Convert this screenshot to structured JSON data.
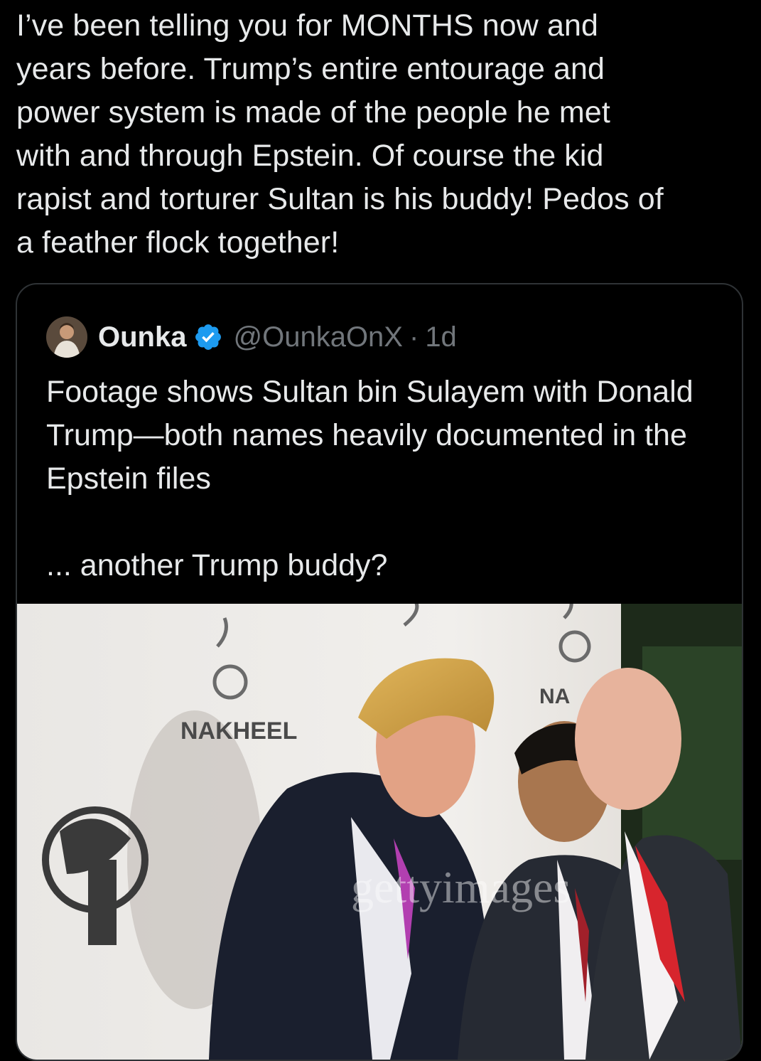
{
  "tweet": {
    "text": "I’ve been telling you for MONTHS now and\nyears before. Trump’s entire entourage and\npower system is made of the people he met\nwith and through Epstein. Of course the kid\nrapist and torturer Sultan is his buddy! Pedos of\na feather flock together!"
  },
  "quoted_tweet": {
    "author_name": "Ounka",
    "handle": "@OunkaOnX",
    "separator": "·",
    "time": "1d",
    "verified_icon": "verified-badge-icon",
    "text_line_1": "Footage shows Sultan bin Sulayem with Donald Trump—both names heavily documented in the Epstein files",
    "text_line_2": "... another Trump buddy?",
    "media": {
      "backdrop_text_1": "NAKHEEL",
      "backdrop_text_2": "NA",
      "watermark": "gettyimages"
    }
  },
  "colors": {
    "background": "#000000",
    "text_primary": "#e7e9ea",
    "text_secondary": "#71767b",
    "border": "#2f3336",
    "verified_blue": "#1d9bf0"
  }
}
